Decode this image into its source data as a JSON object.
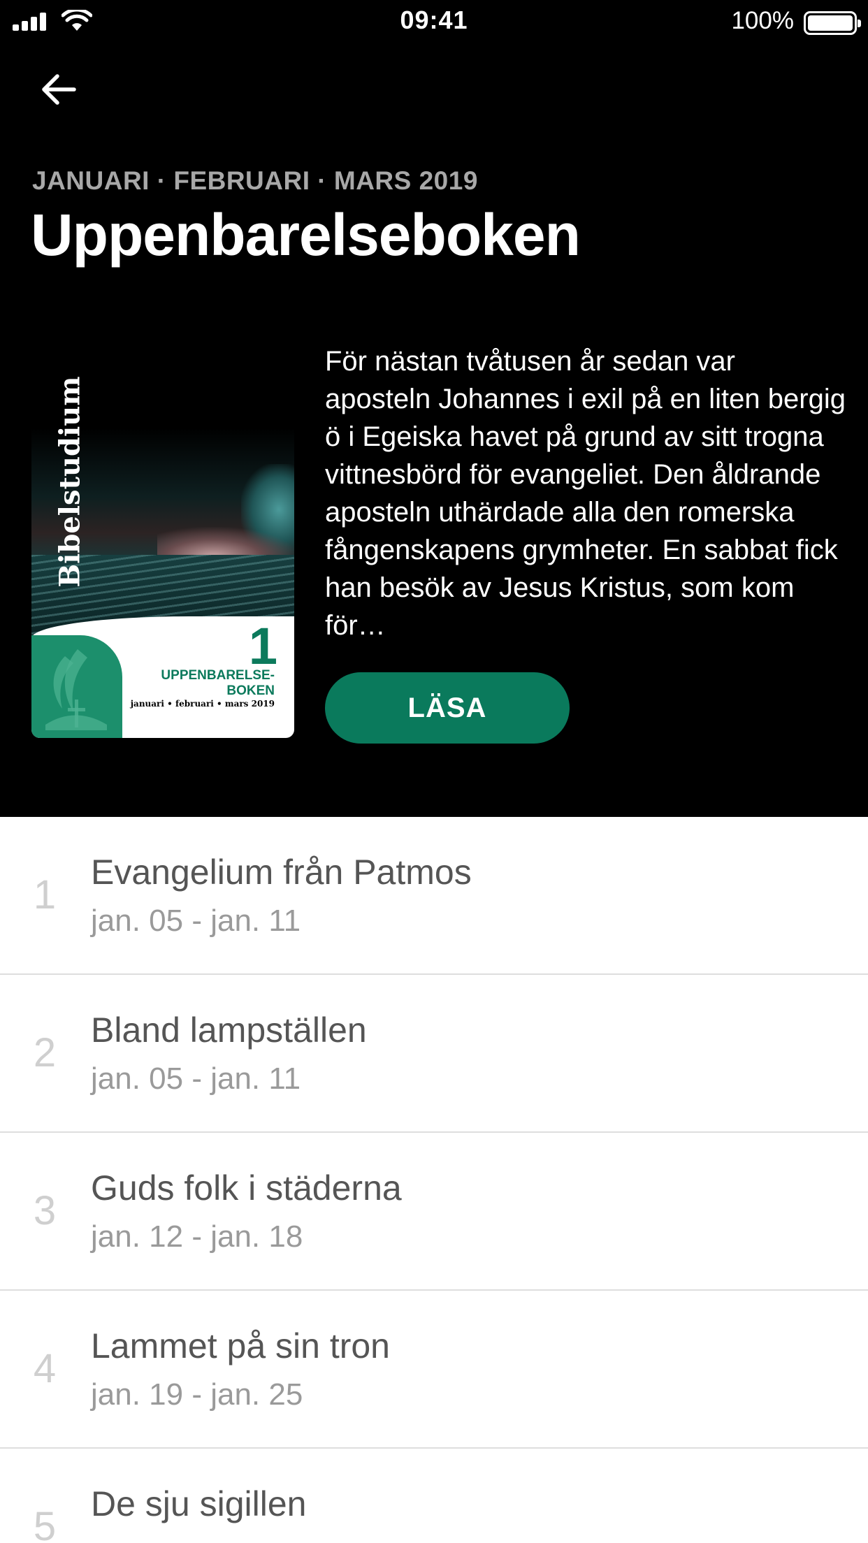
{
  "status_bar": {
    "time": "09:41",
    "battery": "100%"
  },
  "header": {
    "back_icon": "arrow-left-icon",
    "quarter": "JANUARI · FEBRUARI · MARS 2019",
    "title": "Uppenbarelseboken"
  },
  "cover": {
    "spine_text": "Bibelstudium",
    "number": "1",
    "title_line1": "UPPENBARELSE-",
    "title_line2": "BOKEN",
    "subtitle": "januari • februari • mars 2019"
  },
  "description": "För nästan tvåtusen år sedan var aposteln Johannes i exil på en liten bergig ö i Egeiska havet på grund av sitt trogna vittnesbörd för evangeliet. Den åldrande aposteln uthärdade alla den romerska fångenskapens grymheter. En sabbat fick han besök av Jesus Kristus, som kom för…",
  "read_button": "LÄSA",
  "colors": {
    "accent": "#0a7a5c",
    "header_bg": "#000000"
  },
  "lessons": [
    {
      "num": "1",
      "title": "Evangelium från Patmos",
      "dates": "jan. 05 - jan. 11"
    },
    {
      "num": "2",
      "title": "Bland lampställen",
      "dates": "jan. 05 - jan. 11"
    },
    {
      "num": "3",
      "title": "Guds folk i städerna",
      "dates": "jan. 12 - jan. 18"
    },
    {
      "num": "4",
      "title": "Lammet på sin tron",
      "dates": "jan. 19 - jan. 25"
    },
    {
      "num": "5",
      "title": "De sju sigillen",
      "dates": ""
    }
  ]
}
